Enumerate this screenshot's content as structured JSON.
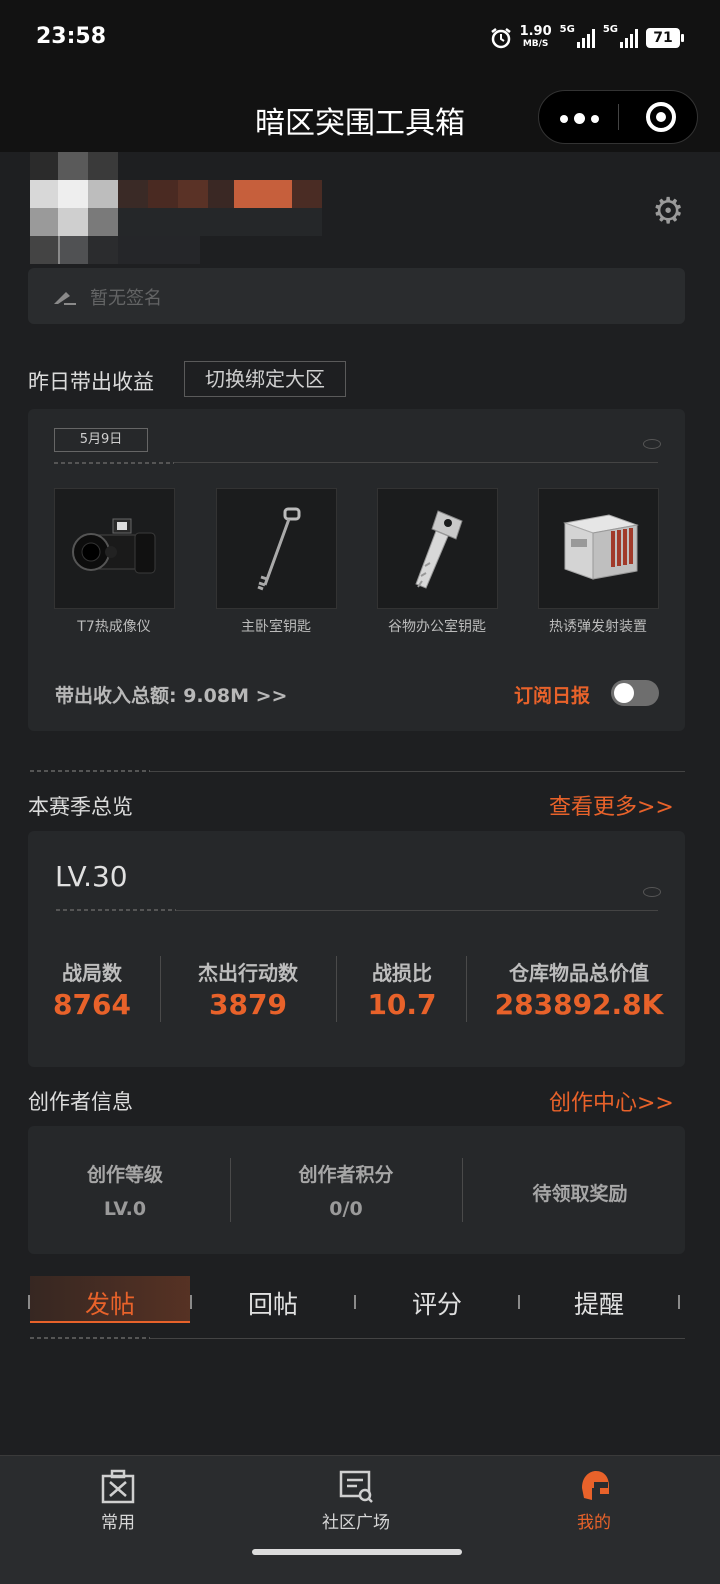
{
  "status_bar": {
    "time": "23:58",
    "speed": "1.90",
    "speed_unit": "MB/S",
    "net1": "5G",
    "net2": "5G",
    "battery": "71"
  },
  "header": {
    "title": "暗区突围工具箱"
  },
  "profile": {
    "signature": "暂无签名"
  },
  "earnings": {
    "section_title": "昨日带出收益",
    "switch_label": "切换绑定大区",
    "date": "5月9日",
    "items": [
      {
        "name": "T7热成像仪",
        "icon": "thermal-scope-icon"
      },
      {
        "name": "主卧室钥匙",
        "icon": "key-icon"
      },
      {
        "name": "谷物办公室钥匙",
        "icon": "key-icon"
      },
      {
        "name": "热诱弹发射装置",
        "icon": "flare-launcher-icon"
      }
    ],
    "total": "带出收入总额: 9.08M >>",
    "subscribe_label": "订阅日报",
    "subscribe_on": false
  },
  "season": {
    "section_title": "本赛季总览",
    "more_link": "查看更多>>",
    "level": "LV.30",
    "stats": [
      {
        "label": "战局数",
        "value": "8764"
      },
      {
        "label": "杰出行动数",
        "value": "3879"
      },
      {
        "label": "战损比",
        "value": "10.7"
      },
      {
        "label": "仓库物品总价值",
        "value": "283892.8K"
      }
    ]
  },
  "creator": {
    "section_title": "创作者信息",
    "center_link": "创作中心>>",
    "level_label": "创作等级",
    "level_value": "LV.0",
    "points_label": "创作者积分",
    "points_value": "0/0",
    "reward_label": "待领取奖励"
  },
  "tabs": [
    "发帖",
    "回帖",
    "评分",
    "提醒"
  ],
  "bottom_nav": [
    {
      "label": "常用",
      "icon": "toolbox-icon"
    },
    {
      "label": "社区广场",
      "icon": "community-board-icon"
    },
    {
      "label": "我的",
      "icon": "helmet-icon"
    }
  ],
  "colors": {
    "accent": "#e8622a",
    "background": "#1e1f21",
    "card": "#26282a"
  }
}
